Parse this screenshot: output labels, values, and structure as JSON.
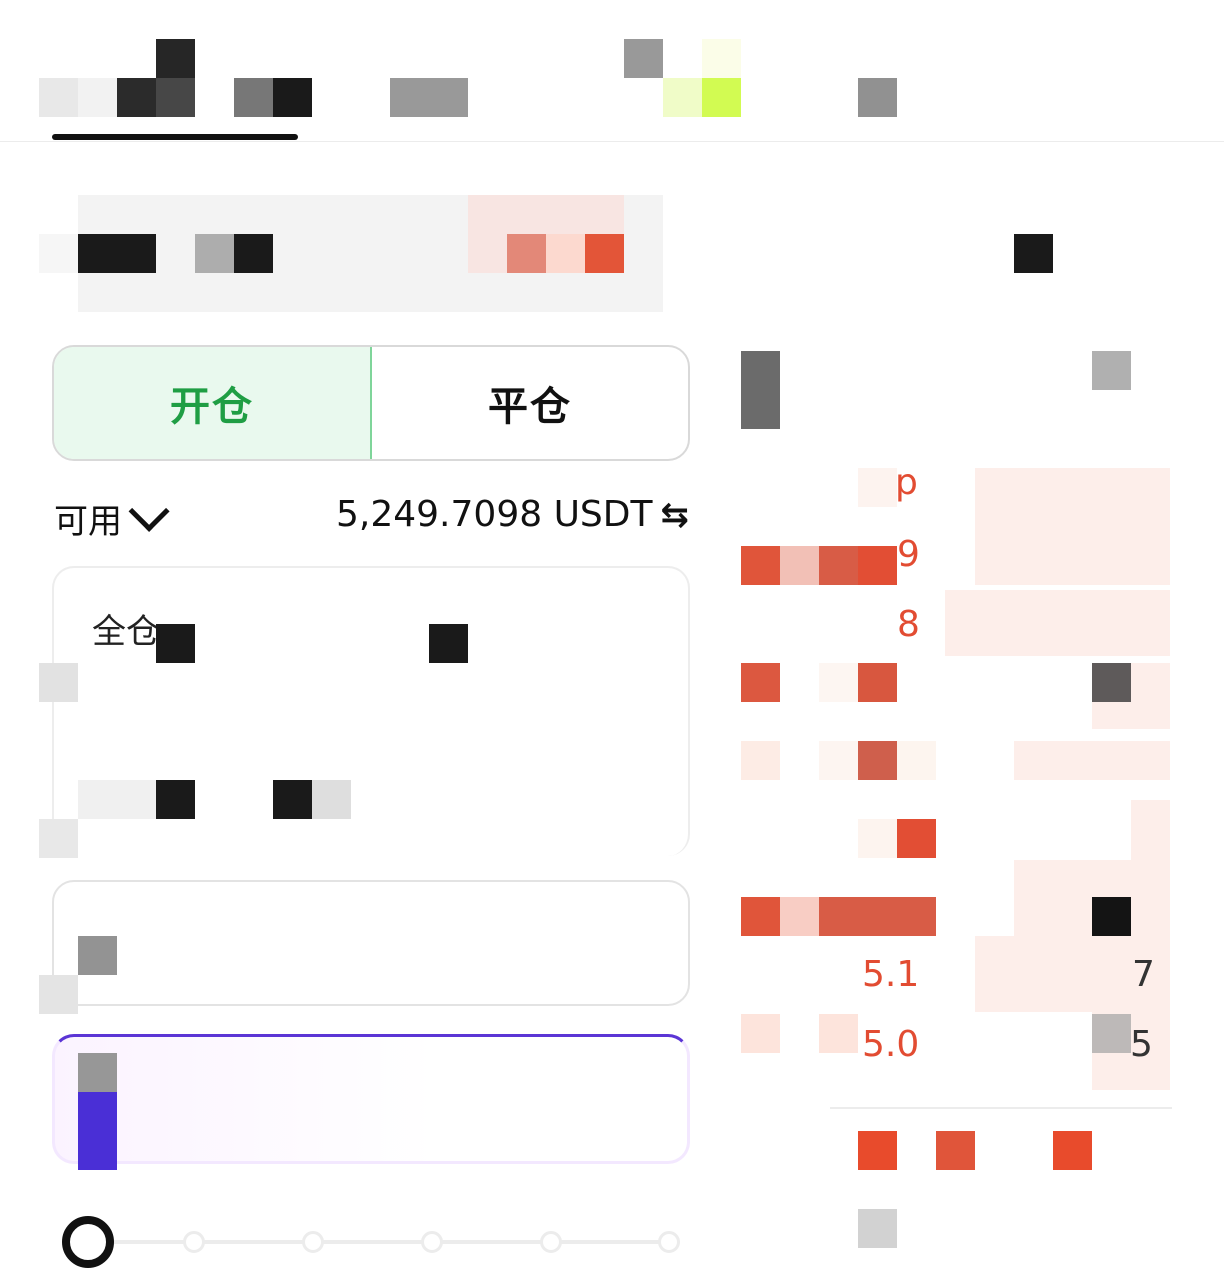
{
  "nav": {
    "tabs": [
      {
        "label": "",
        "active": true
      },
      {
        "label": ""
      },
      {
        "label": ""
      },
      {
        "label": ""
      }
    ]
  },
  "trade_mode": {
    "open_label": "开仓",
    "close_label": "平仓",
    "selected": "open"
  },
  "balance": {
    "label": "可用",
    "value": "5,249.7098 USDT"
  },
  "form": {
    "margin_mode_label": "全仓"
  },
  "order_book": {
    "price_fragments": [
      "p",
      "9",
      "8",
      "5.1",
      "5.0"
    ],
    "qty_fragments": [
      "7",
      "5"
    ]
  },
  "colors": {
    "buy_green": "#1f9e44",
    "sell_red": "#e24c32",
    "accent_purple": "#5b35d5"
  },
  "slider": {
    "value_percent": 0,
    "stops": 6
  }
}
